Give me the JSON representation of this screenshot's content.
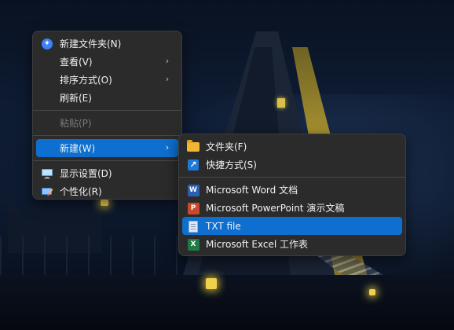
{
  "main_menu": {
    "items": [
      {
        "label": "新建文件夹(N)",
        "icon": "new-folder-icon"
      },
      {
        "label": "查看(V)",
        "has_submenu": true
      },
      {
        "label": "排序方式(O)",
        "has_submenu": true
      },
      {
        "label": "刷新(E)"
      },
      {
        "label": "粘贴(P)",
        "disabled": true
      },
      {
        "label": "新建(W)",
        "has_submenu": true,
        "highlighted": true
      },
      {
        "label": "显示设置(D)",
        "icon": "display-settings-icon"
      },
      {
        "label": "个性化(R)",
        "icon": "personalize-icon"
      }
    ]
  },
  "new_submenu": {
    "items": [
      {
        "label": "文件夹(F)",
        "icon": "folder-icon"
      },
      {
        "label": "快捷方式(S)",
        "icon": "shortcut-icon"
      },
      {
        "label": "Microsoft Word 文档",
        "icon": "word-icon"
      },
      {
        "label": "Microsoft PowerPoint 演示文稿",
        "icon": "powerpoint-icon"
      },
      {
        "label": "TXT file",
        "icon": "txt-file-icon",
        "highlighted": true
      },
      {
        "label": "Microsoft Excel 工作表",
        "icon": "excel-icon"
      }
    ]
  },
  "colors": {
    "menu_bg": "#2b2b2b",
    "highlight": "#0e6fd0",
    "text": "#f2f2f2",
    "disabled_text": "#7a7a7a"
  }
}
